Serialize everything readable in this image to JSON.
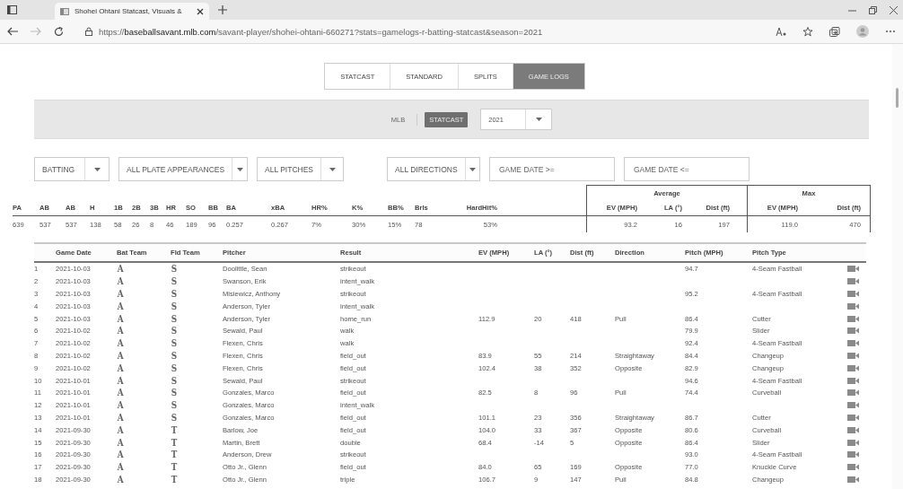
{
  "browser": {
    "tab_title": "Shohei Ohtani Statcast, Visuals &",
    "url": "https://**baseballsavant.mlb.com**/savant-player/shohei-ohtani-660271?stats=gamelogs-r-batting-statcast&season=2021"
  },
  "view_tabs": [
    {
      "label": "STATCAST",
      "selected": false
    },
    {
      "label": "STANDARD",
      "selected": false
    },
    {
      "label": "SPLITS",
      "selected": false
    },
    {
      "label": "GAME LOGS",
      "selected": true
    }
  ],
  "source_toggle": [
    {
      "label": "MLB",
      "selected": false
    },
    {
      "label": "STATCAST",
      "selected": true
    }
  ],
  "season_select": {
    "value": "2021"
  },
  "filters": [
    {
      "kind": "select",
      "value": "BATTING"
    },
    {
      "kind": "select",
      "value": "ALL PLATE APPEARANCES"
    },
    {
      "kind": "select",
      "value": "ALL PITCHES"
    },
    {
      "kind": "select",
      "value": "ALL DIRECTIONS"
    },
    {
      "kind": "date",
      "placeholder": "GAME DATE >="
    },
    {
      "kind": "date",
      "placeholder": "GAME DATE <="
    }
  ],
  "summary": {
    "columns": [
      "PA",
      "AB",
      "AB",
      "H",
      "1B",
      "2B",
      "3B",
      "HR",
      "SO",
      "BB",
      "BA",
      "xBA",
      "HR%",
      "K%",
      "BB%",
      "Brls",
      "HardHit%"
    ],
    "values": [
      "639",
      "537",
      "537",
      "138",
      "58",
      "26",
      "8",
      "46",
      "189",
      "96",
      "0.257",
      "0.267",
      "7%",
      "30%",
      "15%",
      "78",
      "53%"
    ],
    "groups": [
      {
        "label": "Average",
        "columns": [
          "EV (MPH)",
          "LA (°)",
          "Dist (ft)"
        ],
        "values": [
          "93.2",
          "16",
          "197"
        ]
      },
      {
        "label": "Max",
        "columns": [
          "EV (MPH)",
          "Dist (ft)"
        ],
        "values": [
          "119.0",
          "470"
        ]
      }
    ]
  },
  "game_log": {
    "columns": [
      "Game Date",
      "Bat Team",
      "Fld Team",
      "Pitcher",
      "Result",
      "EV (MPH)",
      "LA (°)",
      "Dist (ft)",
      "Direction",
      "Pitch (MPH)",
      "Pitch Type"
    ],
    "rows": [
      {
        "n": "1",
        "date": "2021-10-03",
        "bat": "A",
        "fld": "S",
        "pitcher": "Doolittle, Sean",
        "result": "strikeout",
        "pitch_mph": "94.7",
        "pitch_type": "4-Seam Fastball"
      },
      {
        "n": "2",
        "date": "2021-10-03",
        "bat": "A",
        "fld": "S",
        "pitcher": "Swanson, Erik",
        "result": "intent_walk"
      },
      {
        "n": "3",
        "date": "2021-10-03",
        "bat": "A",
        "fld": "S",
        "pitcher": "Misiewicz, Anthony",
        "result": "strikeout",
        "pitch_mph": "95.2",
        "pitch_type": "4-Seam Fastball"
      },
      {
        "n": "4",
        "date": "2021-10-03",
        "bat": "A",
        "fld": "S",
        "pitcher": "Anderson, Tyler",
        "result": "intent_walk"
      },
      {
        "n": "5",
        "date": "2021-10-03",
        "bat": "A",
        "fld": "S",
        "pitcher": "Anderson, Tyler",
        "result": "home_run",
        "ev": "112.9",
        "la": "20",
        "dist": "418",
        "direction": "Pull",
        "pitch_mph": "86.4",
        "pitch_type": "Cutter"
      },
      {
        "n": "6",
        "date": "2021-10-02",
        "bat": "A",
        "fld": "S",
        "pitcher": "Sewald, Paul",
        "result": "walk",
        "pitch_mph": "79.9",
        "pitch_type": "Slider"
      },
      {
        "n": "7",
        "date": "2021-10-02",
        "bat": "A",
        "fld": "S",
        "pitcher": "Flexen, Chris",
        "result": "walk",
        "pitch_mph": "92.4",
        "pitch_type": "4-Seam Fastball"
      },
      {
        "n": "8",
        "date": "2021-10-02",
        "bat": "A",
        "fld": "S",
        "pitcher": "Flexen, Chris",
        "result": "field_out",
        "ev": "83.9",
        "la": "55",
        "dist": "214",
        "direction": "Straightaway",
        "pitch_mph": "84.4",
        "pitch_type": "Changeup"
      },
      {
        "n": "9",
        "date": "2021-10-02",
        "bat": "A",
        "fld": "S",
        "pitcher": "Flexen, Chris",
        "result": "field_out",
        "ev": "102.4",
        "la": "38",
        "dist": "352",
        "direction": "Opposite",
        "pitch_mph": "82.9",
        "pitch_type": "Changeup"
      },
      {
        "n": "10",
        "date": "2021-10-01",
        "bat": "A",
        "fld": "S",
        "pitcher": "Sewald, Paul",
        "result": "strikeout",
        "pitch_mph": "94.6",
        "pitch_type": "4-Seam Fastball"
      },
      {
        "n": "11",
        "date": "2021-10-01",
        "bat": "A",
        "fld": "S",
        "pitcher": "Gonzales, Marco",
        "result": "field_out",
        "ev": "82.5",
        "la": "8",
        "dist": "96",
        "direction": "Pull",
        "pitch_mph": "74.4",
        "pitch_type": "Curveball"
      },
      {
        "n": "12",
        "date": "2021-10-01",
        "bat": "A",
        "fld": "S",
        "pitcher": "Gonzales, Marco",
        "result": "intent_walk"
      },
      {
        "n": "13",
        "date": "2021-10-01",
        "bat": "A",
        "fld": "S",
        "pitcher": "Gonzales, Marco",
        "result": "field_out",
        "ev": "101.1",
        "la": "23",
        "dist": "356",
        "direction": "Straightaway",
        "pitch_mph": "86.7",
        "pitch_type": "Cutter"
      },
      {
        "n": "14",
        "date": "2021-09-30",
        "bat": "A",
        "fld": "T",
        "pitcher": "Barlow, Joe",
        "result": "field_out",
        "ev": "104.0",
        "la": "33",
        "dist": "367",
        "direction": "Opposite",
        "pitch_mph": "80.6",
        "pitch_type": "Curveball"
      },
      {
        "n": "15",
        "date": "2021-09-30",
        "bat": "A",
        "fld": "T",
        "pitcher": "Martin, Brett",
        "result": "double",
        "ev": "68.4",
        "la": "-14",
        "dist": "5",
        "direction": "Opposite",
        "pitch_mph": "86.4",
        "pitch_type": "Slider"
      },
      {
        "n": "16",
        "date": "2021-09-30",
        "bat": "A",
        "fld": "T",
        "pitcher": "Anderson, Drew",
        "result": "strikeout",
        "pitch_mph": "93.0",
        "pitch_type": "4-Seam Fastball"
      },
      {
        "n": "17",
        "date": "2021-09-30",
        "bat": "A",
        "fld": "T",
        "pitcher": "Otto Jr., Glenn",
        "result": "field_out",
        "ev": "84.0",
        "la": "65",
        "dist": "169",
        "direction": "Opposite",
        "pitch_mph": "77.0",
        "pitch_type": "Knuckle Curve"
      },
      {
        "n": "18",
        "date": "2021-09-30",
        "bat": "A",
        "fld": "T",
        "pitcher": "Otto Jr., Glenn",
        "result": "triple",
        "ev": "106.7",
        "la": "9",
        "dist": "147",
        "direction": "Pull",
        "pitch_mph": "84.8",
        "pitch_type": "Changeup"
      }
    ]
  }
}
